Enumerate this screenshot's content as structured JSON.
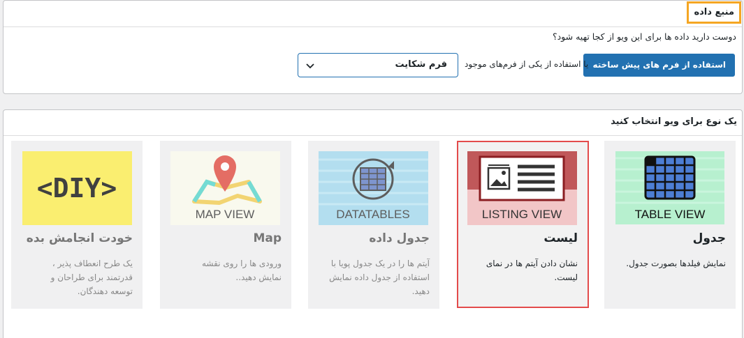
{
  "source_panel": {
    "title": "منبع داده",
    "question": "دوست دارید داده ها برای این ویو از کجا تهیه شود؟",
    "prebuilt_button": "استفاده از فرم های پیش ساخته",
    "or_text": "یا استفاده از یکی از فرم‌های موجود",
    "form_select": {
      "value": "فرم شکایت",
      "icon": "chevron-down-icon"
    }
  },
  "type_panel": {
    "title": "یک نوع برای ویو انتخاب کنید",
    "cards": [
      {
        "id": "table",
        "title": "جدول",
        "desc": "نمایش فیلدها بصورت جدول.",
        "thumb_caption": "TABLE VIEW",
        "selected": false,
        "enabled": true
      },
      {
        "id": "listing",
        "title": "لیست",
        "desc": "نشان دادن آیتم ها در نمای لیست.",
        "thumb_caption": "LISTING VIEW",
        "selected": true,
        "enabled": true
      },
      {
        "id": "datatables",
        "title": "جدول داده",
        "desc": "آیتم ها را در یک جدول پویا با استفاده از جدول داده نمایش دهید.",
        "thumb_caption": "DATATABLES",
        "selected": false,
        "enabled": false
      },
      {
        "id": "map",
        "title": "Map",
        "desc": "ورودی ها را روی نقشه نمایش دهید..",
        "thumb_caption": "MAP VIEW",
        "selected": false,
        "enabled": false
      },
      {
        "id": "diy",
        "title": "خودت انجامش بده",
        "desc": "یک طرح انعطاف پذیر ، قدرتمند برای طراحان و توسعه دهندگان.",
        "thumb_caption": "<DIY>",
        "selected": false,
        "enabled": false
      }
    ]
  },
  "colors": {
    "accent": "#2271b1",
    "selected_border": "#e34b4b",
    "source_title_border": "#f5a623",
    "diy_yellow": "#fcee5a"
  }
}
